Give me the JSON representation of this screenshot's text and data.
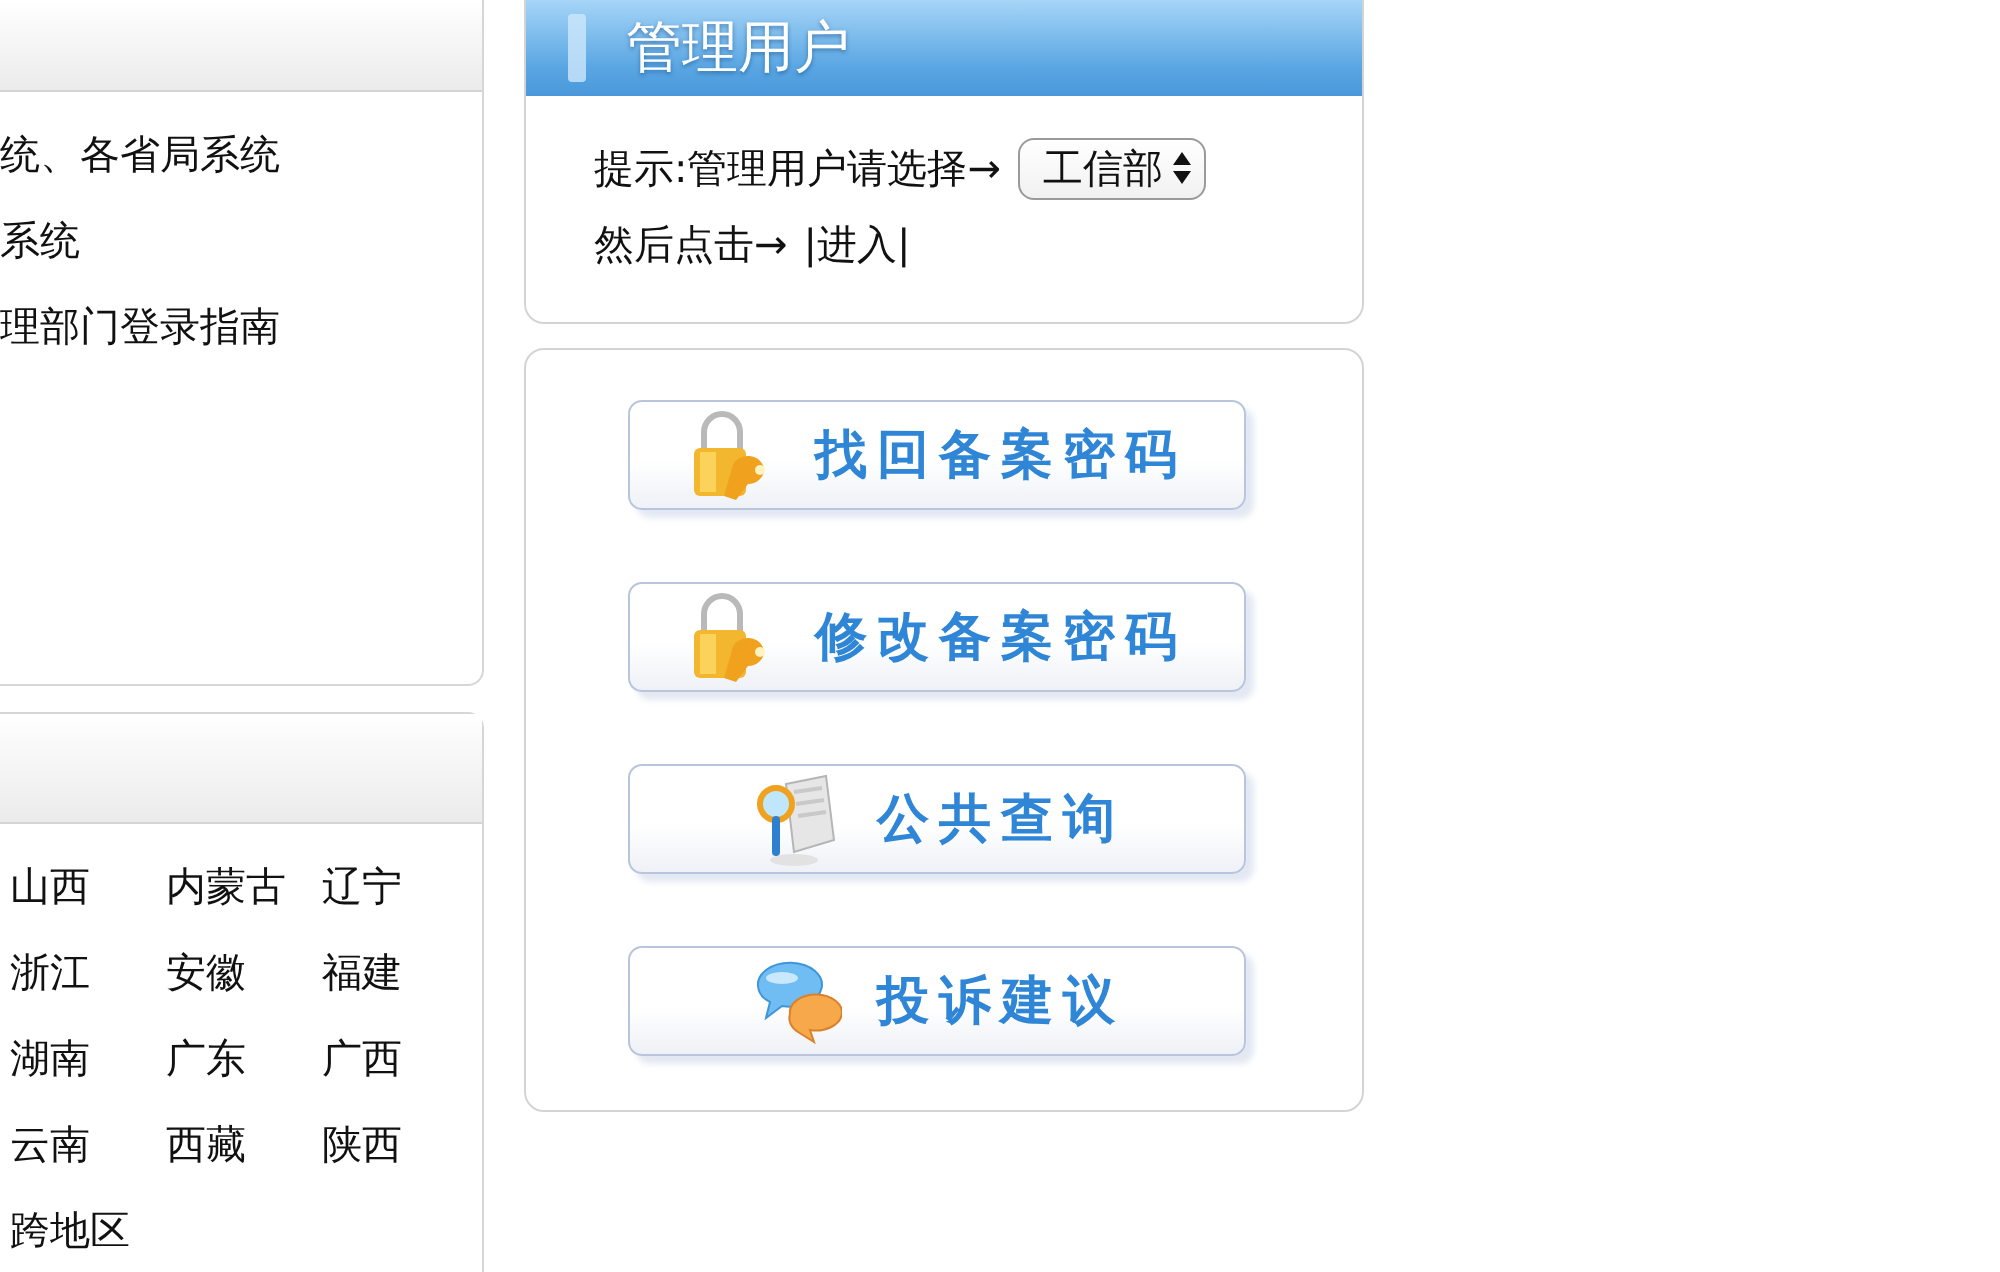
{
  "left_panels": [
    {
      "lines": [
        "统、各省局系统",
        "系统",
        "理部门登录指南"
      ]
    },
    {
      "regions": [
        "山西",
        "内蒙古",
        "辽宁",
        "浙江",
        "安徽",
        "福建",
        "湖南",
        "广东",
        "广西",
        "云南",
        "西藏",
        "陕西",
        "跨地区"
      ]
    }
  ],
  "manage_users": {
    "title": "管理用户",
    "hint": "提示:管理用户请选择→",
    "department_select": {
      "value": "工信部"
    },
    "next_step": "然后点击→",
    "enter_link": "|进入|"
  },
  "actions": [
    {
      "kind": "lock",
      "label": "找回备案密码"
    },
    {
      "kind": "lock",
      "label": "修改备案密码"
    },
    {
      "kind": "search",
      "label": "公共查询"
    },
    {
      "kind": "chat",
      "label": "投诉建议"
    }
  ]
}
